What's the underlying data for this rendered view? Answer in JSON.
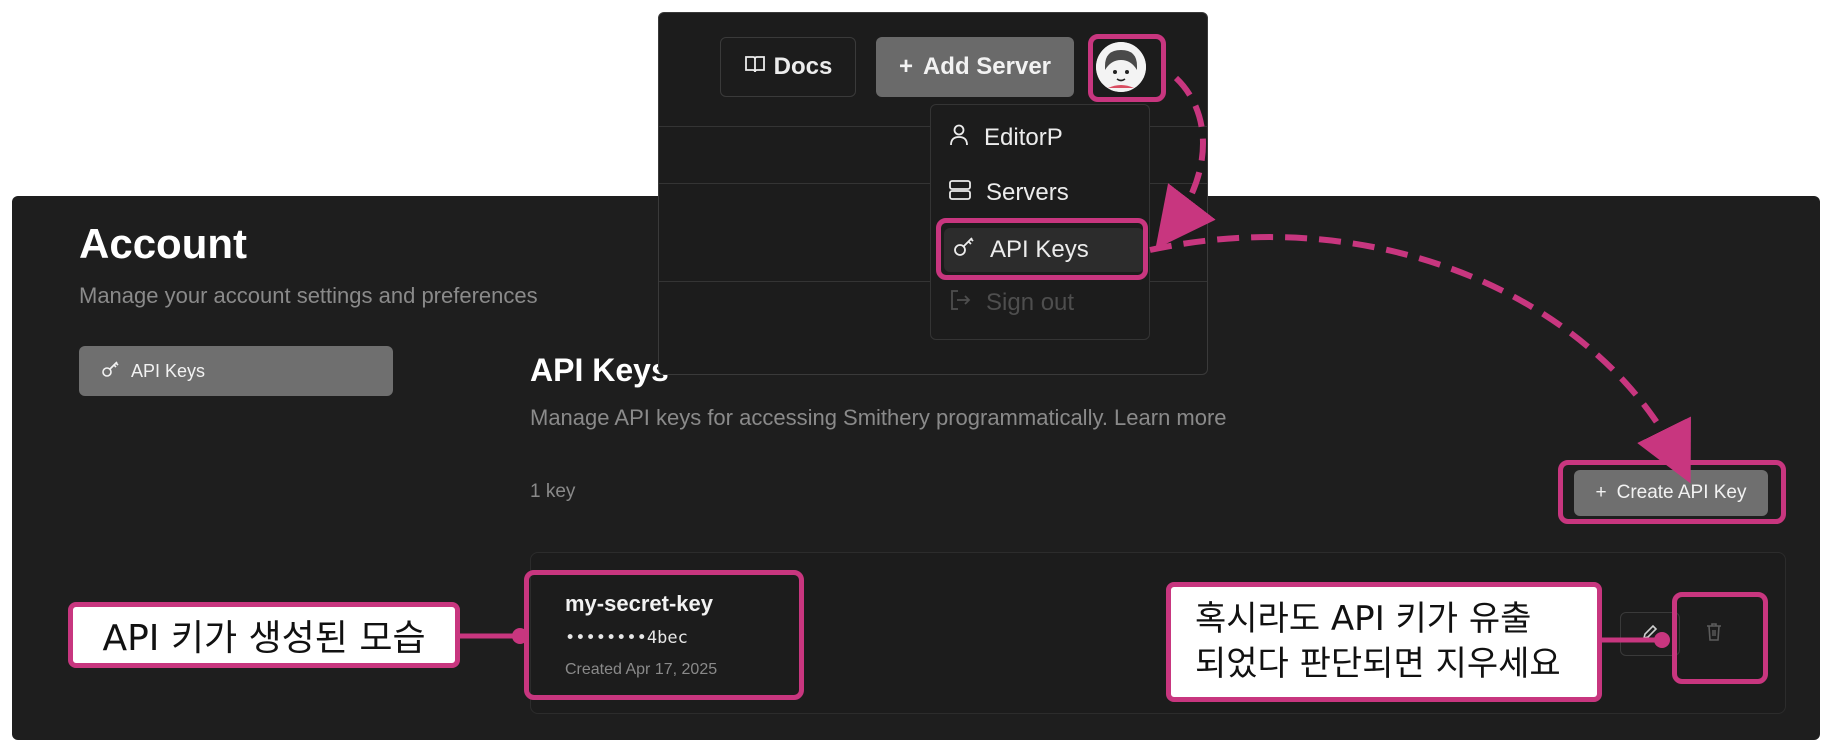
{
  "account": {
    "title": "Account",
    "subtitle": "Manage your account settings and preferences"
  },
  "sidebar": {
    "items": [
      {
        "label": "API Keys",
        "icon": "key-icon",
        "selected": true
      }
    ]
  },
  "api_keys": {
    "title": "API Keys",
    "subtitle": "Manage API keys for accessing Smithery programmatically. Learn more",
    "count": "1 key",
    "create_label": "Create API Key",
    "keys": [
      {
        "name": "my-secret-key",
        "masked": "••••••••4bec",
        "created": "Created Apr 17, 2025"
      }
    ]
  },
  "header": {
    "docs_label": "Docs",
    "add_server_label": "Add Server"
  },
  "user_menu": {
    "items": [
      {
        "label": "EditorP",
        "icon": "user-icon"
      },
      {
        "label": "Servers",
        "icon": "server-icon"
      },
      {
        "label": "API Keys",
        "icon": "key-icon",
        "active": true
      },
      {
        "label": "Sign out",
        "icon": "sign-out-icon",
        "disabled": true
      }
    ]
  },
  "annotations": {
    "left_callout": "API 키가 생성된 모습",
    "right_callout_line1": "혹시라도 API 키가 유출",
    "right_callout_line2": "되었다 판단되면 지우세요",
    "highlight_color": "#c8367f"
  }
}
